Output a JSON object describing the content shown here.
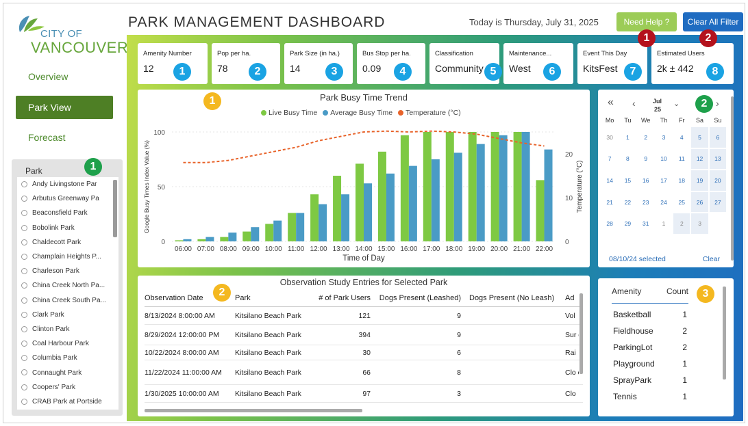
{
  "logo": {
    "city": "CITY OF",
    "name": "VANCOUVER"
  },
  "header": {
    "title": "PARK MANAGEMENT DASHBOARD",
    "today": "Today is Thursday, July 31, 2025",
    "help_label": "Need Help ?",
    "clear_label": "Clear All Filter"
  },
  "nav": [
    {
      "label": "Overview"
    },
    {
      "label": "Park View"
    },
    {
      "label": "Forecast"
    }
  ],
  "park_filter": {
    "title": "Park",
    "items": [
      "Andy Livingstone Par",
      "Arbutus Greenway Pa",
      "Beaconsfield Park",
      "Bobolink Park",
      "Chaldecott Park",
      "Champlain Heights P...",
      "Charleson Park",
      "China Creek North Pa...",
      "China Creek South Pa...",
      "Clark Park",
      "Clinton Park",
      "Coal Harbour Park",
      "Columbia Park",
      "Connaught Park",
      "Coopers' Park",
      "CRAB Park at Portside"
    ]
  },
  "kpis": [
    {
      "label": "Amenity Number",
      "value": "12"
    },
    {
      "label": "Pop per ha.",
      "value": "78"
    },
    {
      "label": "Park Size (in ha.)",
      "value": "14"
    },
    {
      "label": "Bus Stop per ha.",
      "value": "0.09"
    },
    {
      "label": "Classification",
      "value": "Community"
    },
    {
      "label": "Maintenance...",
      "value": "West"
    },
    {
      "label": "Event This Day",
      "value": "KitsFest"
    },
    {
      "label": "Estimated Users",
      "value": "2k ± 442"
    }
  ],
  "badges": {
    "kpi": [
      "1",
      "2",
      "3",
      "4",
      "5",
      "6",
      "7",
      "8"
    ],
    "buttons": [
      "1",
      "2"
    ],
    "sidebar": "1",
    "chart": "1",
    "calendar": "2",
    "table": "2",
    "amenity": "3"
  },
  "colors": {
    "live": "#7ec943",
    "average": "#4a9bc6",
    "temperature": "#e8632a",
    "accent_blue": "#1f6cc1",
    "nav_active": "#4e7f25"
  },
  "chart_data": {
    "type": "bar",
    "title": "Park Busy Time Trend",
    "legend": [
      "Live Busy Time",
      "Average Busy Time",
      "Temperature (°C)"
    ],
    "xlabel": "Time of Day",
    "ylabel": "Google Busy Times Index Value (%)",
    "y2label": "Temperature (°C)",
    "categories": [
      "06:00",
      "07:00",
      "08:00",
      "09:00",
      "10:00",
      "11:00",
      "12:00",
      "13:00",
      "14:00",
      "15:00",
      "16:00",
      "17:00",
      "18:00",
      "19:00",
      "20:00",
      "21:00",
      "22:00"
    ],
    "series": [
      {
        "name": "Live Busy Time",
        "values": [
          1,
          2,
          4,
          9,
          16,
          26,
          43,
          60,
          71,
          82,
          97,
          100,
          100,
          100,
          100,
          100,
          56
        ]
      },
      {
        "name": "Average Busy Time",
        "values": [
          2,
          4,
          8,
          13,
          19,
          26,
          34,
          43,
          53,
          62,
          69,
          75,
          81,
          89,
          97,
          100,
          84
        ]
      },
      {
        "name": "Temperature (°C)",
        "values": [
          18,
          18,
          18.5,
          19.5,
          20.5,
          21.5,
          23,
          24,
          25,
          25.2,
          25,
          25.2,
          25,
          24.5,
          23.5,
          22.5,
          21.8
        ]
      }
    ],
    "ylim": [
      0,
      100
    ],
    "yticks": [
      0,
      50,
      100
    ],
    "y2lim": [
      0,
      25
    ],
    "y2ticks": [
      0,
      10,
      20
    ]
  },
  "calendar": {
    "month": "Jul",
    "year": "25",
    "dow": [
      "Mo",
      "Tu",
      "We",
      "Th",
      "Fr",
      "Sa",
      "Su"
    ],
    "weeks": [
      [
        "30",
        "1",
        "2",
        "3",
        "4",
        "5",
        "6"
      ],
      [
        "7",
        "8",
        "9",
        "10",
        "11",
        "12",
        "13"
      ],
      [
        "14",
        "15",
        "16",
        "17",
        "18",
        "19",
        "20"
      ],
      [
        "21",
        "22",
        "23",
        "24",
        "25",
        "26",
        "27"
      ],
      [
        "28",
        "29",
        "30",
        "31",
        "1",
        "2",
        "3"
      ]
    ],
    "selected_text": "08/10/24 selected",
    "clear_label": "Clear"
  },
  "observations": {
    "title": "Observation Study Entries for Selected Park",
    "columns": [
      "Observation Date",
      "Park",
      "# of Park Users",
      "Dogs Present (Leashed)",
      "Dogs Present (No Leash)",
      "Ad"
    ],
    "rows": [
      [
        "8/13/2024 8:00:00 AM",
        "Kitsilano Beach Park",
        "121",
        "9",
        "",
        "Vol"
      ],
      [
        "8/29/2024 12:00:00 PM",
        "Kitsilano Beach Park",
        "394",
        "9",
        "",
        "Sur on"
      ],
      [
        "10/22/2024 8:00:00 AM",
        "Kitsilano Beach Park",
        "30",
        "6",
        "",
        "Rai"
      ],
      [
        "11/22/2024 11:00:00 AM",
        "Kitsilano Beach Park",
        "66",
        "8",
        "",
        "Clo cap"
      ],
      [
        "1/30/2025 10:00:00 AM",
        "Kitsilano Beach Park",
        "97",
        "3",
        "",
        "Clo"
      ]
    ]
  },
  "amenities": {
    "header": [
      "Amenity",
      "Count"
    ],
    "rows": [
      [
        "Basketball",
        "1"
      ],
      [
        "Fieldhouse",
        "2"
      ],
      [
        "ParkingLot",
        "2"
      ],
      [
        "Playground",
        "1"
      ],
      [
        "SprayPark",
        "1"
      ],
      [
        "Tennis",
        "1"
      ]
    ]
  }
}
